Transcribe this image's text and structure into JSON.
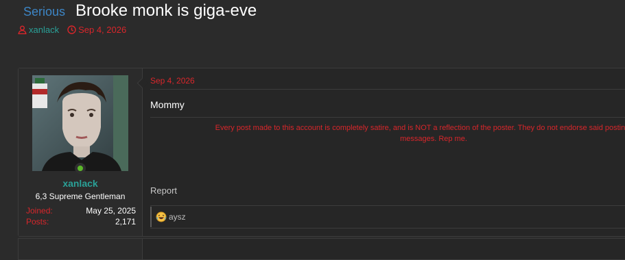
{
  "thread": {
    "prefix": "Serious",
    "title": "Brooke monk is giga-eve",
    "author": "xanlack",
    "date": "Sep 4, 2026"
  },
  "post": {
    "user": {
      "name": "xanlack",
      "title": "6,3 Supreme Gentleman",
      "joined_label": "Joined:",
      "joined_value": "May 25, 2025",
      "posts_label": "Posts:",
      "posts_value": "2,171",
      "online": true
    },
    "date": "Sep 4, 2026",
    "body": "Mommy",
    "signature_line1": "Every post made to this account is completely satire, and is NOT a reflection of the poster. They do not endorse said postings. I am",
    "signature_line2": "messages. Rep me.",
    "report_label": "Report",
    "reactions_text": "aysz"
  },
  "icons": {
    "author": "user-icon",
    "date": "clock-icon",
    "reaction": "laughing-emoji-icon",
    "online": "online-indicator-icon"
  },
  "colors": {
    "background": "#2b2b2b",
    "post_background": "#262626",
    "accent_teal": "#2aa198",
    "accent_red": "#d9262b",
    "prefix_blue": "#3d86c6",
    "online_green": "#5cb82a"
  }
}
